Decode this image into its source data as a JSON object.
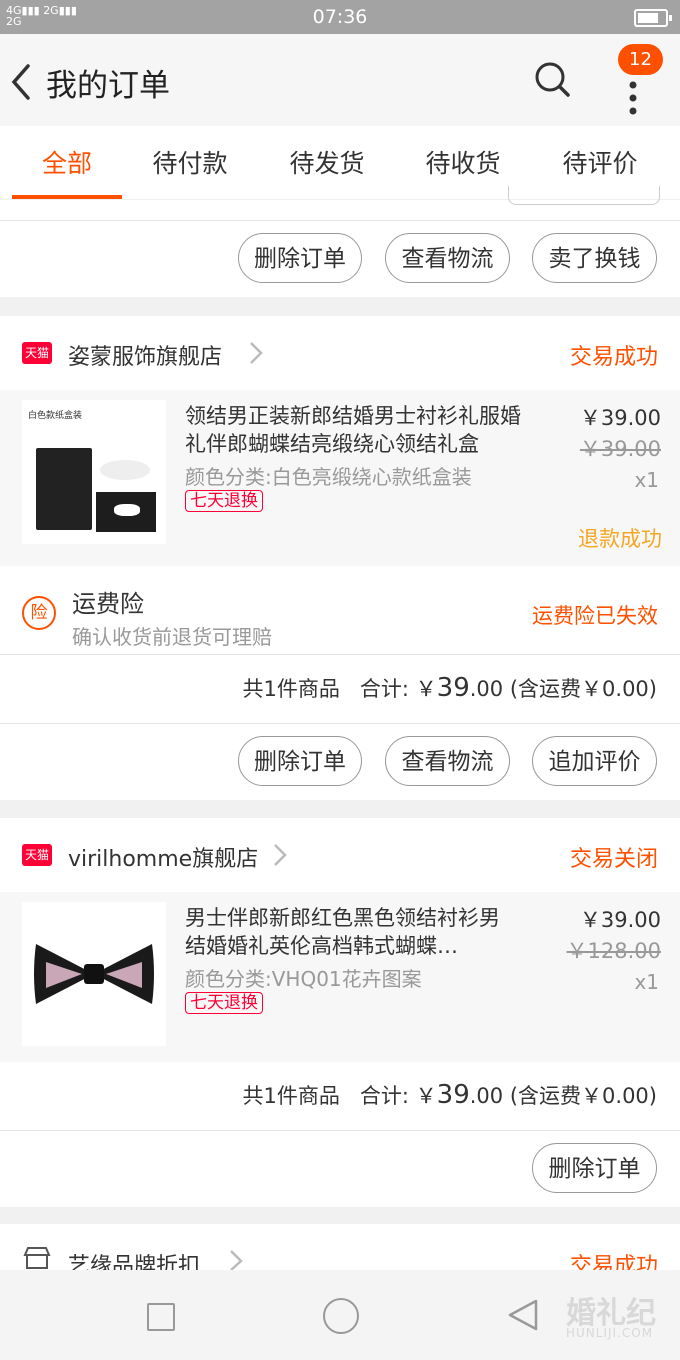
{
  "status_bar": {
    "signal1": "4G",
    "signal2": "2G",
    "signal3": "2G",
    "time": "07:36"
  },
  "header": {
    "title": "我的订单",
    "badge_count": "12"
  },
  "tabs": [
    {
      "label": "全部",
      "active": true
    },
    {
      "label": "待付款"
    },
    {
      "label": "待发货"
    },
    {
      "label": "待收货"
    },
    {
      "label": "待评价"
    }
  ],
  "top_order": {
    "buttons": [
      "删除订单",
      "查看物流",
      "卖了换钱"
    ]
  },
  "order1": {
    "platform_tag": "天猫",
    "shop_name": "姿蒙服饰旗舰店",
    "status": "交易成功",
    "product": {
      "image_caption": "白色款纸盒装",
      "title": "领结男正装新郎结婚男士衬衫礼服婚礼伴郎蝴蝶结亮缎绕心领结礼盒",
      "spec": "颜色分类:白色亮缎绕心款纸盒装",
      "service_tag": "七天退换",
      "price": "￥39.00",
      "original_price": "￥39.00",
      "qty": "x1",
      "refund_status": "退款成功"
    },
    "insurance": {
      "icon_char": "险",
      "title": "运费险",
      "subtitle": "确认收货前退货可理赔",
      "status": "运费险已失效"
    },
    "summary": {
      "count_text": "共1件商品",
      "total_label": "合计:",
      "currency": "￥",
      "total_int": "39",
      "total_dec": ".00",
      "shipping": "(含运费￥0.00)"
    },
    "buttons": [
      "删除订单",
      "查看物流",
      "追加评价"
    ]
  },
  "order2": {
    "platform_tag": "天猫",
    "shop_name": "virilhomme旗舰店",
    "status": "交易关闭",
    "product": {
      "title": "男士伴郎新郎红色黑色领结衬衫男 结婚婚礼英伦高档韩式蝴蝶…",
      "spec": "颜色分类:VHQ01花卉图案",
      "service_tag": "七天退换",
      "price": "￥39.00",
      "original_price": "￥128.00",
      "qty": "x1"
    },
    "summary": {
      "count_text": "共1件商品",
      "total_label": "合计:",
      "currency": "￥",
      "total_int": "39",
      "total_dec": ".00",
      "shipping": "(含运费￥0.00)"
    },
    "buttons": [
      "删除订单"
    ]
  },
  "order3": {
    "shop_name": "艺缘品牌折扣",
    "status": "交易成功"
  },
  "watermark": {
    "line1": "婚礼纪",
    "line2": "HUNLIJI.COM"
  },
  "colors": {
    "accent": "#ff5000",
    "tmall": "#ff0036",
    "refund": "#f5a623"
  }
}
